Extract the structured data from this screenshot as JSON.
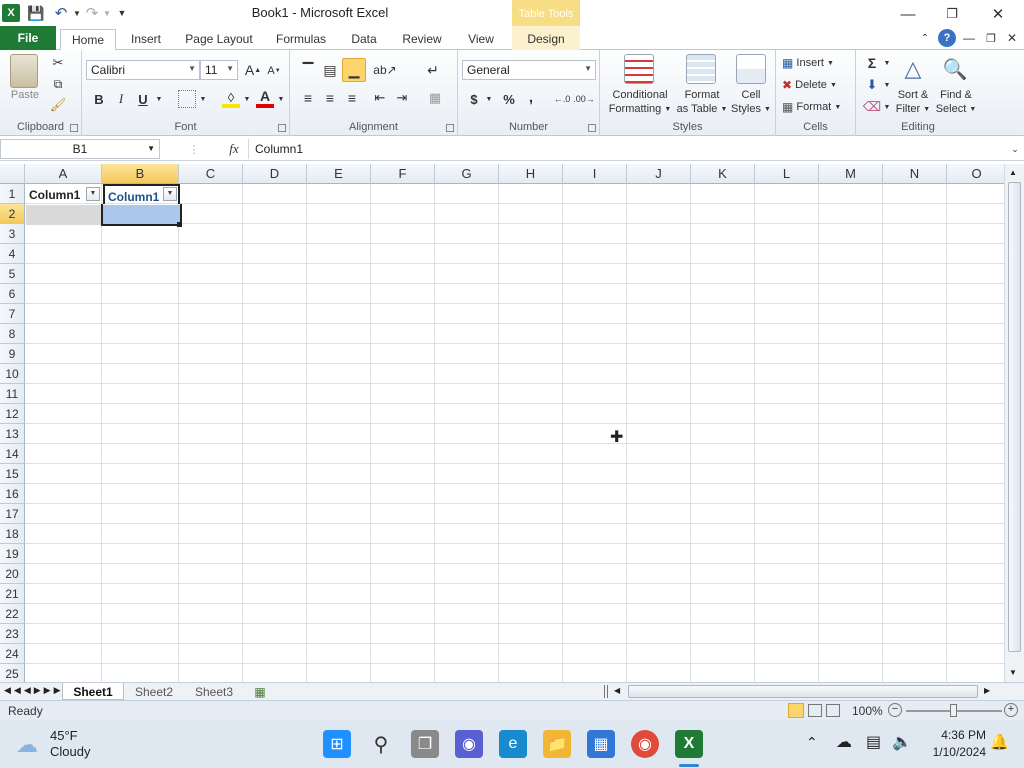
{
  "window": {
    "title": "Book1  -  Microsoft Excel",
    "contextual_tab_header": "Table Tools"
  },
  "tabs": [
    "File",
    "Home",
    "Insert",
    "Page Layout",
    "Formulas",
    "Data",
    "Review",
    "View",
    "Design"
  ],
  "ribbon": {
    "clipboard": {
      "label": "Clipboard",
      "paste": "Paste"
    },
    "font": {
      "label": "Font",
      "name": "Calibri",
      "size": "11",
      "bold": "B",
      "italic": "I",
      "underline": "U"
    },
    "alignment": {
      "label": "Alignment"
    },
    "number": {
      "label": "Number",
      "format": "General",
      "currency": "$",
      "percent": "%",
      "comma": ","
    },
    "styles": {
      "label": "Styles",
      "conditional": "Conditional",
      "conditional2": "Formatting",
      "format_table": "Format",
      "format_table2": "as Table",
      "cell_styles": "Cell",
      "cell_styles2": "Styles"
    },
    "cells": {
      "label": "Cells",
      "insert": "Insert",
      "delete": "Delete",
      "format": "Format"
    },
    "editing": {
      "label": "Editing",
      "sort": "Sort &",
      "sort2": "Filter",
      "find": "Find &",
      "find2": "Select"
    }
  },
  "formula_bar": {
    "name_box": "B1",
    "fx": "fx",
    "value": "Column1"
  },
  "grid": {
    "columns": [
      "A",
      "B",
      "C",
      "D",
      "E",
      "F",
      "G",
      "H",
      "I",
      "J",
      "K",
      "L",
      "M",
      "N",
      "O"
    ],
    "rows": [
      "1",
      "2",
      "3",
      "4",
      "5",
      "6",
      "7",
      "8",
      "9",
      "10",
      "11",
      "12",
      "13",
      "14",
      "15",
      "16",
      "17",
      "18",
      "19",
      "20",
      "21",
      "22",
      "23",
      "24",
      "25"
    ],
    "cells": {
      "A1": "Column1",
      "B1": "Column1"
    },
    "selected_column": "B",
    "selected_row": "2"
  },
  "sheets": [
    "Sheet1",
    "Sheet2",
    "Sheet3"
  ],
  "status": {
    "text": "Ready",
    "zoom": "100%"
  },
  "taskbar": {
    "temperature": "45°F",
    "weather": "Cloudy",
    "time": "4:36 PM",
    "date": "1/10/2024"
  },
  "colors": {
    "excel_green": "#1f7a36",
    "selection_orange": "#f3c95d",
    "selected_cell_blue": "#a9c8ec"
  }
}
